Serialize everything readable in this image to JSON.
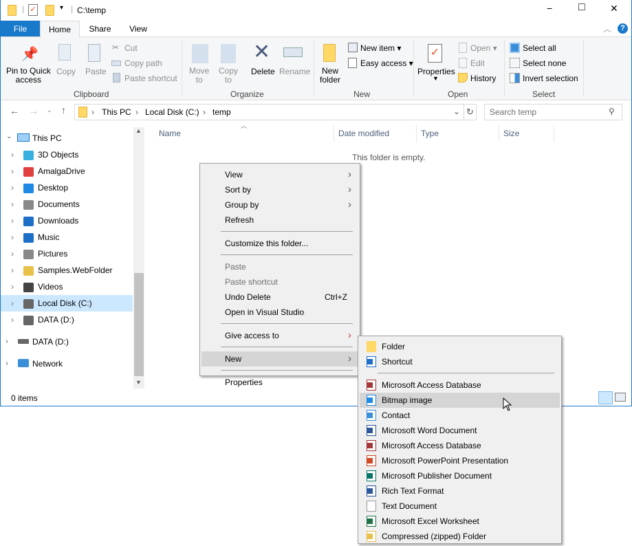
{
  "window": {
    "title": "C:\\temp",
    "minimize": "−",
    "maximize": "□",
    "close": "✕"
  },
  "tabs": {
    "file": "File",
    "home": "Home",
    "share": "Share",
    "view": "View"
  },
  "ribbon": {
    "pin": "Pin to Quick access",
    "pin1": "Pin to Quick",
    "pin2": "access",
    "copy": "Copy",
    "paste": "Paste",
    "cut": "Cut",
    "copy_path": "Copy path",
    "paste_shortcut": "Paste shortcut",
    "clipboard": "Clipboard",
    "move_to1": "Move",
    "move_to2": "to",
    "copy_to1": "Copy",
    "copy_to2": "to",
    "delete": "Delete",
    "rename": "Rename",
    "organize": "Organize",
    "new_folder1": "New",
    "new_folder2": "folder",
    "new_item": "New item",
    "easy_access": "Easy access",
    "new": "New",
    "properties": "Properties",
    "open": "Open",
    "edit": "Edit",
    "history": "History",
    "open_group": "Open",
    "select_all": "Select all",
    "select_none": "Select none",
    "invert_selection": "Invert selection",
    "select": "Select"
  },
  "address": {
    "crumbs": [
      "This PC",
      "Local Disk (C:)",
      "temp"
    ],
    "search_placeholder": "Search temp"
  },
  "columns": [
    "Name",
    "Date modified",
    "Type",
    "Size"
  ],
  "empty_text": "This folder is empty.",
  "nav": {
    "this_pc": "This PC",
    "items": [
      "3D Objects",
      "AmalgaDrive",
      "Desktop",
      "Documents",
      "Downloads",
      "Music",
      "Pictures",
      "Samples.WebFolder",
      "Videos",
      "Local Disk (C:)",
      "DATA (D:)"
    ],
    "selected": "Local Disk (C:)",
    "data_d": "DATA (D:)",
    "network": "Network"
  },
  "status": {
    "items": "0 items"
  },
  "context_menu": [
    {
      "label": "View",
      "submenu": true
    },
    {
      "label": "Sort by",
      "submenu": true
    },
    {
      "label": "Group by",
      "submenu": true
    },
    {
      "label": "Refresh"
    },
    {
      "sep": true
    },
    {
      "label": "Customize this folder..."
    },
    {
      "sep": true
    },
    {
      "label": "Paste",
      "disabled": true
    },
    {
      "label": "Paste shortcut",
      "disabled": true
    },
    {
      "label": "Undo Delete",
      "shortcut": "Ctrl+Z"
    },
    {
      "label": "Open in Visual Studio"
    },
    {
      "sep": true
    },
    {
      "label": "Give access to",
      "submenu": true
    },
    {
      "sep": true
    },
    {
      "label": "New",
      "submenu": true,
      "highlighted": true
    },
    {
      "sep": true
    },
    {
      "label": "Properties"
    }
  ],
  "new_submenu": [
    {
      "label": "Folder",
      "icon": "folder-icon",
      "color": "#ffd866"
    },
    {
      "label": "Shortcut",
      "icon": "shortcut-icon",
      "color": "#1e6fc8"
    },
    {
      "sep": true
    },
    {
      "label": "Microsoft Access Database",
      "icon": "access-icon",
      "color": "#a4373a"
    },
    {
      "label": "Bitmap image",
      "icon": "bitmap-icon",
      "color": "#1e88e5",
      "highlighted": true
    },
    {
      "label": "Contact",
      "icon": "contact-icon",
      "color": "#3a8fd8"
    },
    {
      "label": "Microsoft Word Document",
      "icon": "word-icon",
      "color": "#2b579a"
    },
    {
      "label": "Microsoft Access Database",
      "icon": "access-icon",
      "color": "#a4373a"
    },
    {
      "label": "Microsoft PowerPoint Presentation",
      "icon": "powerpoint-icon",
      "color": "#d24726"
    },
    {
      "label": "Microsoft Publisher Document",
      "icon": "publisher-icon",
      "color": "#077568"
    },
    {
      "label": "Rich Text Format",
      "icon": "word-icon",
      "color": "#2b579a"
    },
    {
      "label": "Text Document",
      "icon": "text-document-icon",
      "color": "#ffffff"
    },
    {
      "label": "Microsoft Excel Worksheet",
      "icon": "excel-icon",
      "color": "#217346"
    },
    {
      "label": "Compressed (zipped) Folder",
      "icon": "zip-folder-icon",
      "color": "#e8c04a"
    }
  ]
}
